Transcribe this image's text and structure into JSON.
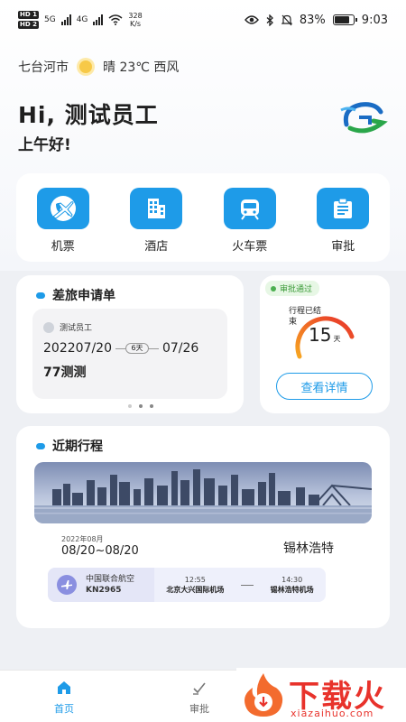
{
  "status_bar": {
    "network_left": "5G",
    "network_right": "4G",
    "speed": "328\nK/s",
    "battery": "83%",
    "battery_level": 0.83,
    "time": "9:03"
  },
  "weather": {
    "city": "七台河市",
    "icon": "sun-icon",
    "condition": "晴 23℃ 西风"
  },
  "greeting": {
    "title": "Hi, 测试员工",
    "subtitle": "上午好!"
  },
  "menu": [
    {
      "label": "机票",
      "icon": "plane-globe-icon"
    },
    {
      "label": "酒店",
      "icon": "hotel-icon"
    },
    {
      "label": "火车票",
      "icon": "train-icon"
    },
    {
      "label": "审批",
      "icon": "approval-icon"
    }
  ],
  "application": {
    "title": "差旅申请单",
    "person": "测试员工",
    "start": "202207/20",
    "days": "6天",
    "end": "07/26",
    "name": "77测测"
  },
  "approval_status": {
    "badge": "审批通过",
    "ring_label": "行程已结束",
    "ring_value": "15",
    "ring_unit": "天",
    "button": "查看详情"
  },
  "recent_trip": {
    "title": "近期行程",
    "month": "2022年08月",
    "range": "08/20~08/20",
    "destination": "锡林浩特",
    "airline": "中国联合航空",
    "flight_no": "KN2965",
    "dep_time": "12:55",
    "dep_airport": "北京大兴国际机场",
    "arr_time": "14:30",
    "arr_airport": "锡林浩特机场"
  },
  "tabs": [
    {
      "label": "首页",
      "icon": "home-icon",
      "active": true
    },
    {
      "label": "审批",
      "icon": "approval-check-icon",
      "active": false
    }
  ],
  "watermark": {
    "text": "下载火",
    "url": "xiazaihuo.com"
  },
  "colors": {
    "accent": "#1e9be8",
    "success": "#4caf50",
    "ring_start": "#f7a521",
    "ring_end": "#e8322b",
    "watermark": "#e8322b"
  }
}
